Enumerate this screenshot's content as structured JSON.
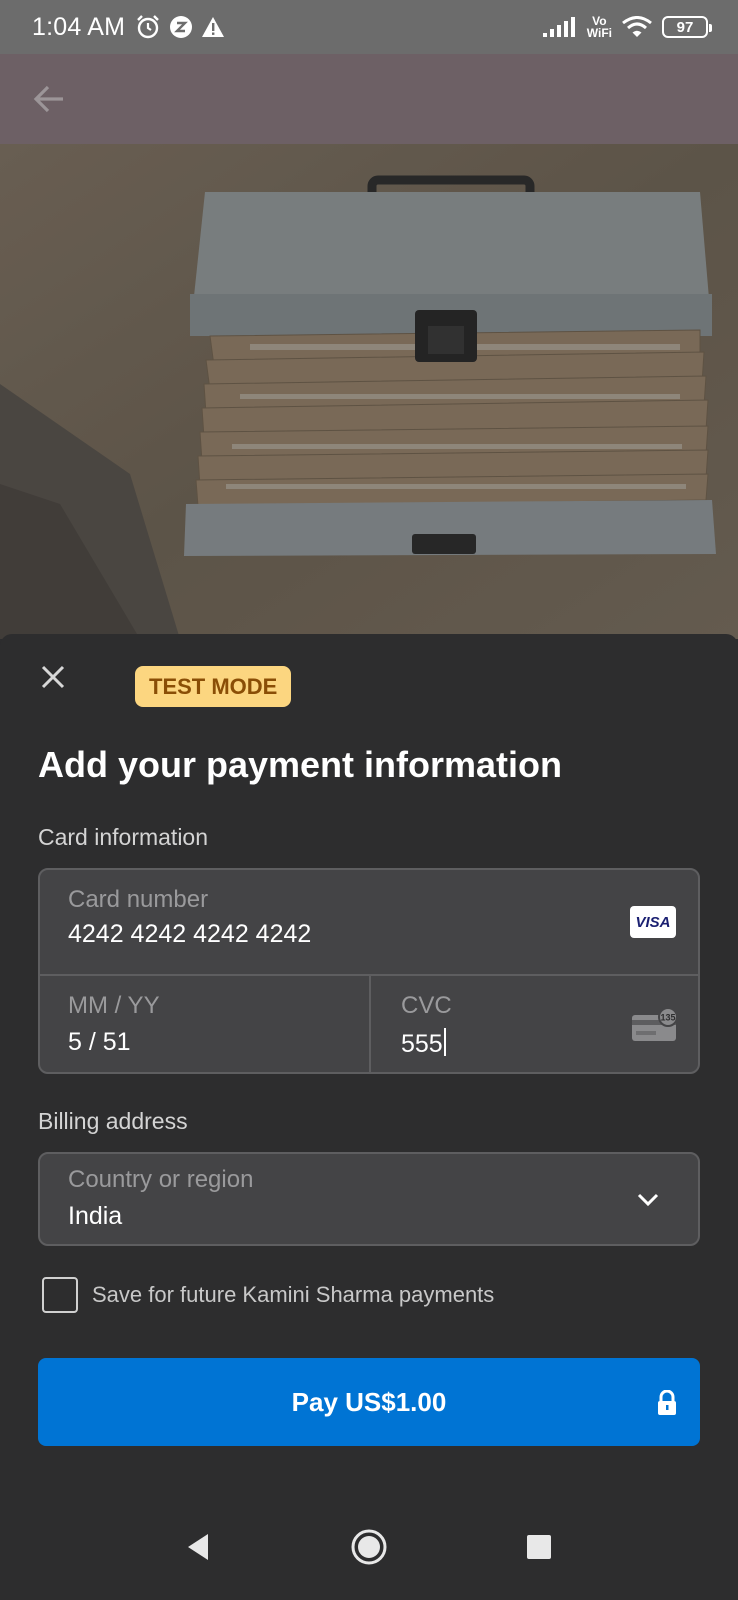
{
  "status_bar": {
    "time": "1:04 AM",
    "vowifi_top": "Vo",
    "vowifi_bottom": "WiFi",
    "battery": "97"
  },
  "sheet": {
    "badge": "TEST MODE",
    "title": "Add your payment information",
    "card_section_label": "Card information",
    "card_number_label": "Card number",
    "card_number_value": "4242 4242 4242 4242",
    "card_brand": "VISA",
    "expiry_label": "MM / YY",
    "expiry_value": "5 / 51",
    "cvc_label": "CVC",
    "cvc_value": "555",
    "cvc_icon_text": "135",
    "billing_section_label": "Billing address",
    "country_label": "Country or region",
    "country_value": "India",
    "save_label": "Save for future Kamini Sharma payments",
    "save_checked": false,
    "pay_label": "Pay US$1.00"
  },
  "colors": {
    "accent": "#0074d4",
    "badge_bg": "#fcd680",
    "badge_text": "#8a4e06",
    "sheet_bg": "#2d2d2e",
    "field_bg": "#444446"
  },
  "icons": {
    "back": "arrow-left-icon",
    "close": "close-icon",
    "chevron": "chevron-down-icon",
    "lock": "lock-icon",
    "alarm": "alarm-icon",
    "warning": "warning-icon",
    "wifi": "wifi-icon",
    "signal": "signal-icon"
  }
}
